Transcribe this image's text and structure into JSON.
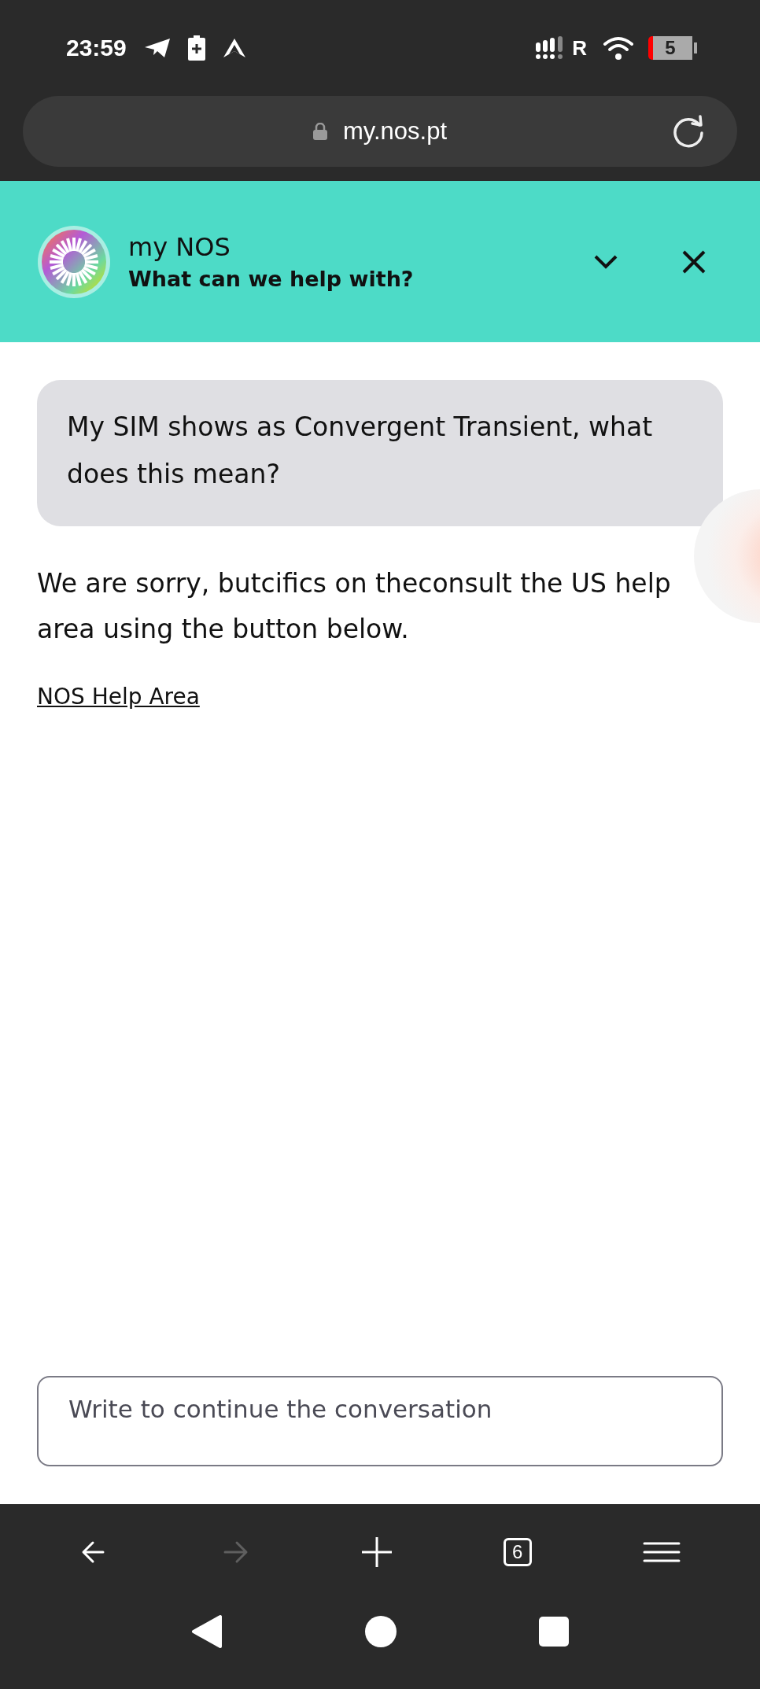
{
  "status_bar": {
    "time": "23:59",
    "network": "R",
    "battery": "5"
  },
  "address_bar": {
    "url": "my.nos.pt"
  },
  "chat_header": {
    "title": "my NOS",
    "subtitle": "What can we help with?"
  },
  "messages": [
    {
      "kind": "user",
      "text": "My SIM shows as Convergent Transient, what does this mean?"
    },
    {
      "kind": "bot",
      "text": "We are sorry, butcifics on theconsult the US help area using the button below."
    },
    {
      "kind": "link",
      "text": "NOS Help Area"
    }
  ],
  "composer": {
    "placeholder": "Write to continue the conversation"
  },
  "browser_toolbar": [
    {
      "kind": "back",
      "disabled": false
    },
    {
      "kind": "forward",
      "disabled": true
    },
    {
      "kind": "new_tab",
      "disabled": false
    },
    {
      "kind": "tabs",
      "label": "6",
      "disabled": false
    },
    {
      "kind": "menu",
      "disabled": false
    }
  ]
}
